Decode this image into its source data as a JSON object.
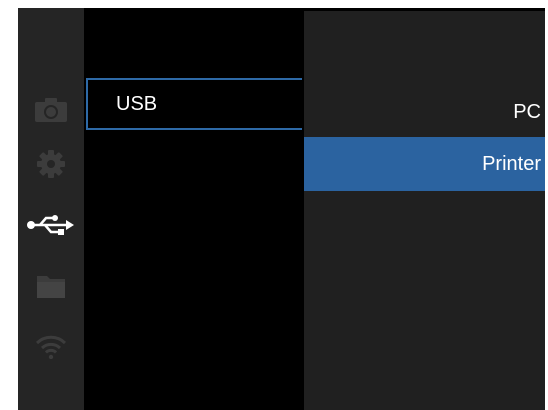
{
  "sidebar": {
    "icons": [
      {
        "name": "camera-icon",
        "active": false
      },
      {
        "name": "gear-icon",
        "active": false
      },
      {
        "name": "usb-icon",
        "active": true
      },
      {
        "name": "folder-icon",
        "active": false
      },
      {
        "name": "wifi-icon",
        "active": false
      }
    ]
  },
  "menu": {
    "selected_label": "USB"
  },
  "submenu": {
    "options": [
      {
        "label": "PC",
        "selected": false
      },
      {
        "label": "Printer",
        "selected": true
      }
    ]
  },
  "colors": {
    "accent": "#2b63a0",
    "inactive_icon": "#3c3c3c",
    "active_icon": "#ffffff"
  }
}
